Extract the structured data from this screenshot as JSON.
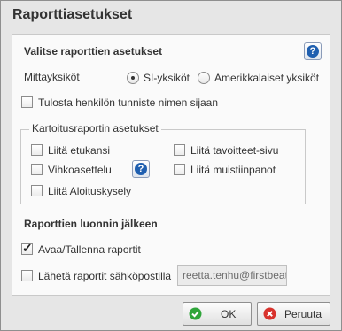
{
  "dialog": {
    "title": "Raporttiasetukset"
  },
  "report_settings": {
    "heading": "Valitse raporttien asetukset",
    "help_symbol": "?",
    "units_label": "Mittayksiköt",
    "units_options": [
      {
        "label": "SI-yksiköt",
        "selected": true
      },
      {
        "label": "Amerikkalaiset yksiköt",
        "selected": false
      }
    ],
    "print_id_label": "Tulosta henkilön tunniste nimen sijaan",
    "print_id_checked": false
  },
  "survey_report": {
    "legend": "Kartoitusraportin asetukset",
    "options": {
      "cover": {
        "label": "Liitä etukansi",
        "checked": false
      },
      "goals": {
        "label": "Liitä tavoitteet-sivu",
        "checked": false
      },
      "load": {
        "label": "Vihkoasettelu",
        "checked": false
      },
      "notes": {
        "label": "Liitä muistiinpanot",
        "checked": false
      },
      "start": {
        "label": "Liitä Aloituskysely",
        "checked": false
      }
    },
    "help_symbol": "?"
  },
  "after_generation": {
    "heading": "Raporttien luonnin jälkeen",
    "open_save_label": "Avaa/Tallenna raportit",
    "open_save_checked": true,
    "send_email_label": "Lähetä raportit sähköpostilla",
    "send_email_checked": false,
    "email_value": "reetta.tenhu@firstbeat"
  },
  "buttons": {
    "ok_label": "OK",
    "cancel_label": "Peruuta"
  },
  "colors": {
    "ok_icon": "#2fa53a",
    "cancel_icon": "#d8322c",
    "help_icon": "#1f5fb0"
  },
  "icons": {
    "help": "help-icon",
    "ok": "checkmark-icon",
    "cancel": "close-icon"
  }
}
